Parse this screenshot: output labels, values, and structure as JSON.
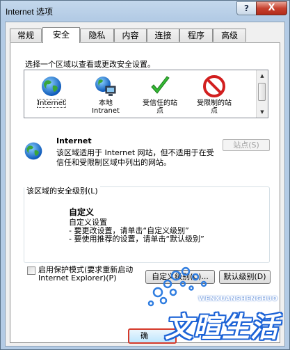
{
  "window": {
    "title": "Internet 选项",
    "help": "?",
    "close": "X"
  },
  "tabs": [
    {
      "label": "常规"
    },
    {
      "label": "安全"
    },
    {
      "label": "隐私"
    },
    {
      "label": "内容"
    },
    {
      "label": "连接"
    },
    {
      "label": "程序"
    },
    {
      "label": "高级"
    }
  ],
  "security": {
    "instruction": "选择一个区域以查看或更改安全设置。",
    "zones": [
      {
        "label": "Internet",
        "icon": "globe-icon"
      },
      {
        "label": "本地\nIntranet",
        "icon": "intranet-icon"
      },
      {
        "label": "受信任的站\n点",
        "icon": "check-icon"
      },
      {
        "label": "受限制的站\n点",
        "icon": "prohibited-icon"
      }
    ],
    "selected_zone": {
      "name": "Internet",
      "description": "该区域适用于 Internet 网站，但不适用于在受信任和受限制区域中列出的网站。"
    },
    "sites_button": "站点(S)",
    "level_group_label": "该区域的安全级别(L)",
    "level_title": "自定义",
    "level_lines": "自定义设置\n- 要更改设置，请单击“自定义级别”\n- 要使用推荐的设置，请单击“默认级别”",
    "protected_mode_label": "启用保护模式(要求重新启动\nInternet Explorer)(P)",
    "custom_level_button": "自定义级别(C)...",
    "default_level_button": "默认级别(D)"
  },
  "ok_button": "确",
  "watermark": {
    "en": "WENXUANSHENGHUO",
    "cn": "文暄生活"
  },
  "colors": {
    "accent": "#1d63d6",
    "highlight": "#d5392a"
  }
}
